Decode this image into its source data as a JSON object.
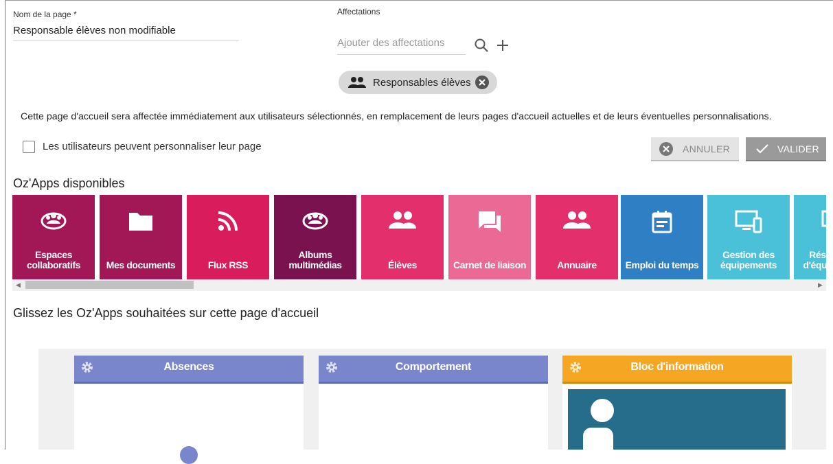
{
  "form": {
    "page_name_label": "Nom de la page *",
    "page_name_value": "Responsable élèves non modifiable",
    "assignments_label": "Affectations",
    "assignments_placeholder": "Ajouter des affectations",
    "search_icon": "search-icon",
    "add_icon": "plus-icon"
  },
  "chip": {
    "icon": "users-icon",
    "label": "Responsables élèves",
    "remove_icon": "close-circle-icon"
  },
  "notice": "Cette page d'accueil sera affectée immédiatement aux utilisateurs sélectionnés, en remplacement de leurs pages d'accueil actuelles et de leurs éventuelles personnalisations.",
  "personalize": {
    "label": "Les utilisateurs peuvent personnaliser leur page",
    "checked": false
  },
  "actions": {
    "cancel_label": "ANNULER",
    "validate_label": "VALIDER"
  },
  "apps_title": "Oz'Apps disponibles",
  "apps": [
    {
      "label": "Espaces collaboratifs",
      "icon": "group-icon",
      "color": "#a21755"
    },
    {
      "label": "Mes documents",
      "icon": "folder-icon",
      "color": "#a21755"
    },
    {
      "label": "Flux RSS",
      "icon": "rss-icon",
      "color": "#d91d5c"
    },
    {
      "label": "Albums multimédias",
      "icon": "group-icon",
      "color": "#7a1250"
    },
    {
      "label": "Élèves",
      "icon": "users-icon",
      "color": "#e32f6b"
    },
    {
      "label": "Carnet de liaison",
      "icon": "chat-icon",
      "color": "#ea6a95"
    },
    {
      "label": "Annuaire",
      "icon": "users-icon",
      "color": "#e32f6b"
    },
    {
      "label": "Emploi du temps",
      "icon": "calendar-icon",
      "color": "#2f7fc4"
    },
    {
      "label": "Gestion des équipements",
      "icon": "devices-icon",
      "color": "#4bc0d9"
    },
    {
      "label": "Réservation d'équipements",
      "icon": "devices-icon",
      "color": "#4bc0d9"
    }
  ],
  "drop_title": "Glissez les Oz'Apps souhaitées sur cette page d'accueil",
  "widgets": [
    {
      "title": "Absences",
      "color": "#7986cb",
      "border": "#5c6bc0"
    },
    {
      "title": "Comportement",
      "color": "#7986cb",
      "border": "#5c6bc0"
    },
    {
      "title": "Bloc d'information",
      "color": "#f5a623",
      "border": "#d48806"
    }
  ]
}
